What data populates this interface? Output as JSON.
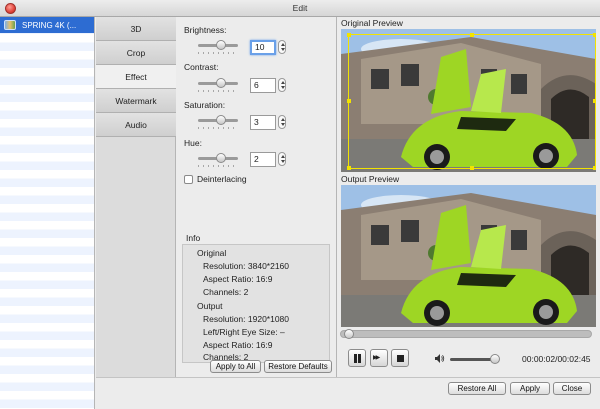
{
  "window": {
    "title": "Edit"
  },
  "file_list": {
    "items": [
      {
        "label": "SPRING 4K (...",
        "selected": true
      }
    ]
  },
  "tabs": [
    {
      "label": "3D",
      "active": false
    },
    {
      "label": "Crop",
      "active": false
    },
    {
      "label": "Effect",
      "active": true
    },
    {
      "label": "Watermark",
      "active": false
    },
    {
      "label": "Audio",
      "active": false
    }
  ],
  "effect": {
    "brightness": {
      "label": "Brightness:",
      "value": "10",
      "slider_fraction": 0.55
    },
    "contrast": {
      "label": "Contrast:",
      "value": "6",
      "slider_fraction": 0.55
    },
    "saturation": {
      "label": "Saturation:",
      "value": "3",
      "slider_fraction": 0.55
    },
    "hue": {
      "label": "Hue:",
      "value": "2",
      "slider_fraction": 0.55
    },
    "deinterlacing": {
      "label": "Deinterlacing",
      "checked": false
    }
  },
  "info": {
    "title": "Info",
    "original_heading": "Original",
    "original_resolution": "Resolution: 3840*2160",
    "original_aspect": "Aspect Ratio: 16:9",
    "original_channels": "Channels: 2",
    "output_heading": "Output",
    "output_resolution": "Resolution: 1920*1080",
    "output_lr_size": "Left/Right Eye Size: –",
    "output_aspect": "Aspect Ratio: 16:9",
    "output_channels": "Channels: 2"
  },
  "buttons": {
    "apply_to_all": "Apply to All",
    "restore_defaults": "Restore Defaults",
    "restore_all": "Restore All",
    "apply": "Apply",
    "close": "Close"
  },
  "preview": {
    "original_label": "Original Preview",
    "output_label": "Output Preview",
    "crop_color": "#f2e300"
  },
  "player": {
    "timecode": "00:00:02/00:02:45",
    "progress_fraction": 0.01,
    "volume_fraction": 0.9
  },
  "colors": {
    "selection": "#2d6cd2",
    "car": "#9ed624"
  }
}
